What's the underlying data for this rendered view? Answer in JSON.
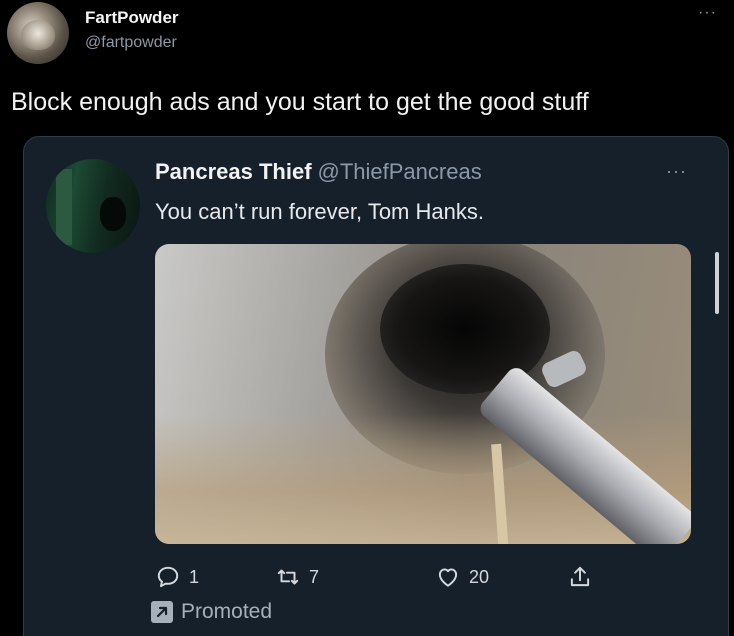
{
  "outer_tweet": {
    "name": "FartPowder",
    "handle": "@fartpowder",
    "more_label": "···",
    "text": "Block enough ads and you start to get the good stuff"
  },
  "quoted_tweet": {
    "name": "Pancreas Thief",
    "handle": "@ThiefPancreas",
    "more_label": "···",
    "text": "You can’t run forever, Tom Hanks.",
    "actions": {
      "replies": "1",
      "retweets": "7",
      "likes": "20"
    },
    "promoted_label": "Promoted"
  },
  "icons": {
    "reply": "comment-bubble-icon",
    "retweet": "retweet-icon",
    "like": "heart-icon",
    "share": "share-icon",
    "promoted": "promoted-arrow-icon"
  },
  "colors": {
    "background": "#000000",
    "card": "#15202b",
    "muted_text": "#8b98a5"
  }
}
